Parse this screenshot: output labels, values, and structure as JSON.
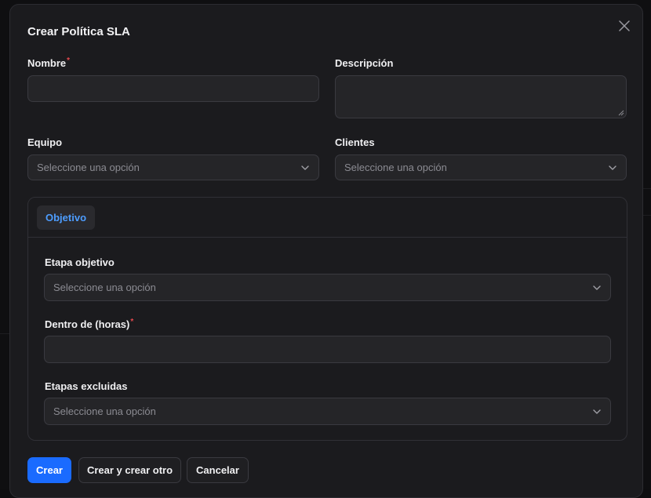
{
  "modal": {
    "title": "Crear Política SLA",
    "close_icon": "close-icon"
  },
  "form": {
    "nombre": {
      "label": "Nombre",
      "required_mark": "*",
      "value": ""
    },
    "descripcion": {
      "label": "Descripción",
      "value": ""
    },
    "equipo": {
      "label": "Equipo",
      "placeholder": "Seleccione una opción"
    },
    "clientes": {
      "label": "Clientes",
      "placeholder": "Seleccione una opción"
    }
  },
  "panel": {
    "tabs": [
      {
        "label": "Objetivo",
        "active": true
      }
    ],
    "etapa_objetivo": {
      "label": "Etapa objetivo",
      "placeholder": "Seleccione una opción"
    },
    "dentro_de_horas": {
      "label": "Dentro de (horas)",
      "required_mark": "*",
      "value": ""
    },
    "etapas_excluidas": {
      "label": "Etapas excluidas",
      "placeholder": "Seleccione una opción"
    }
  },
  "actions": {
    "create_label": "Crear",
    "create_another_label": "Crear y crear otro",
    "cancel_label": "Cancelar"
  },
  "colors": {
    "accent": "#1a6bff",
    "tab_active_text": "#4d9dff",
    "required": "#e5484d",
    "surface": "#1b1b1e"
  }
}
